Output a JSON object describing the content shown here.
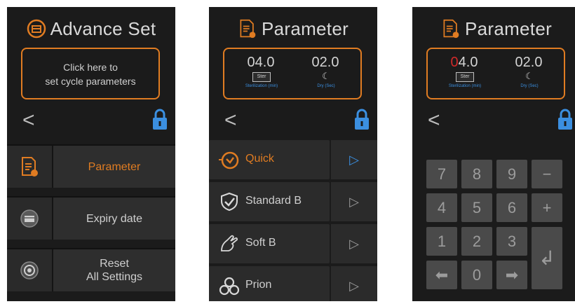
{
  "screens": {
    "advance": {
      "title": "Advance Set",
      "info_line1": "Click here to",
      "info_line2": "set cycle parameters",
      "back": "<",
      "menu": [
        {
          "label": "Parameter",
          "icon": "parameter-icon",
          "color": "#e07c22"
        },
        {
          "label": "Expiry date",
          "icon": "expiry-icon"
        },
        {
          "label_line1": "Reset",
          "label_line2": "All Settings",
          "icon": "reset-icon"
        }
      ]
    },
    "parameter": {
      "title": "Parameter",
      "value1": "04.0",
      "value2": "02.0",
      "badge1": "Ster",
      "label1": "Sterilization (min)",
      "label2": "Dry (Sec)",
      "back": "<",
      "cycles": [
        {
          "label": "Quick",
          "icon": "quick-icon",
          "color": "#e07c22"
        },
        {
          "label": "Standard B",
          "icon": "shield-check-icon"
        },
        {
          "label": "Soft B",
          "icon": "glove-icon"
        },
        {
          "label": "Prion",
          "icon": "prion-icon"
        }
      ],
      "arrow": "▷"
    },
    "keypad_screen": {
      "title": "Parameter",
      "value1_first": "0",
      "value1_rest": "4.0",
      "value2": "02.0",
      "badge1": "Ster",
      "label1": "Sterilization (min)",
      "label2": "Dry (Sec)",
      "back": "<",
      "keys": [
        "7",
        "8",
        "9",
        "−",
        "4",
        "5",
        "6",
        "+",
        "1",
        "2",
        "3",
        "↲",
        "⬅",
        "0",
        "➡"
      ]
    }
  },
  "colors": {
    "accent": "#e07c22",
    "lock": "#3b8fe0",
    "highlight": "#d22a2a"
  }
}
